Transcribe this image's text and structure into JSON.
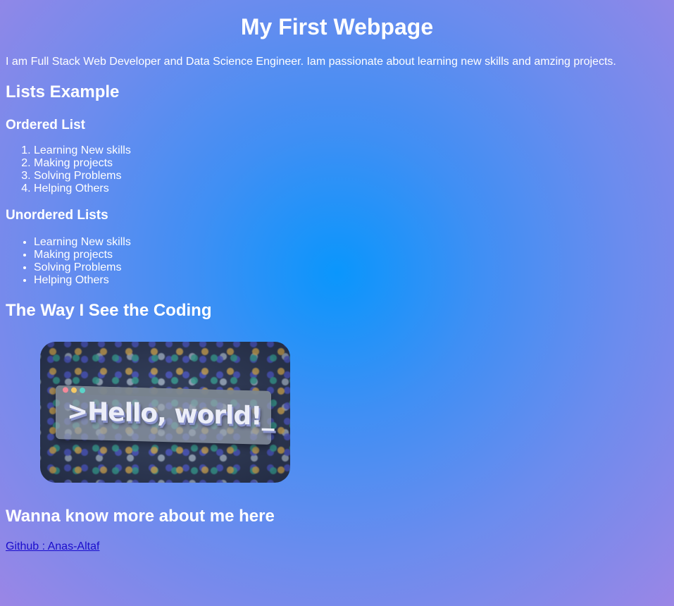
{
  "header": {
    "title": "My First Webpage"
  },
  "intro": {
    "text": "I am Full Stack Web Developer and Data Science Engineer. Iam passionate about learning new skills and amzing projects."
  },
  "lists_section": {
    "heading": "Lists Example",
    "ordered": {
      "heading": "Ordered List",
      "items": [
        "Learning New skills",
        "Making projects",
        "Solving Problems",
        "Helping Others"
      ]
    },
    "unordered": {
      "heading": "Unordered Lists",
      "items": [
        "Learning New skills",
        "Making projects",
        "Solving Problems",
        "Helping Others"
      ]
    }
  },
  "coding_section": {
    "heading": "The Way I See the Coding",
    "image": {
      "caption_text": ">Hello, world!_"
    }
  },
  "more_section": {
    "heading": "Wanna know more about me here",
    "link_label": "Github : Anas-Altaf"
  },
  "colors": {
    "link": "#1a0dcc",
    "text": "#ffffff",
    "background_center": "#0a96fc",
    "background_edge": "#9a86e6"
  }
}
